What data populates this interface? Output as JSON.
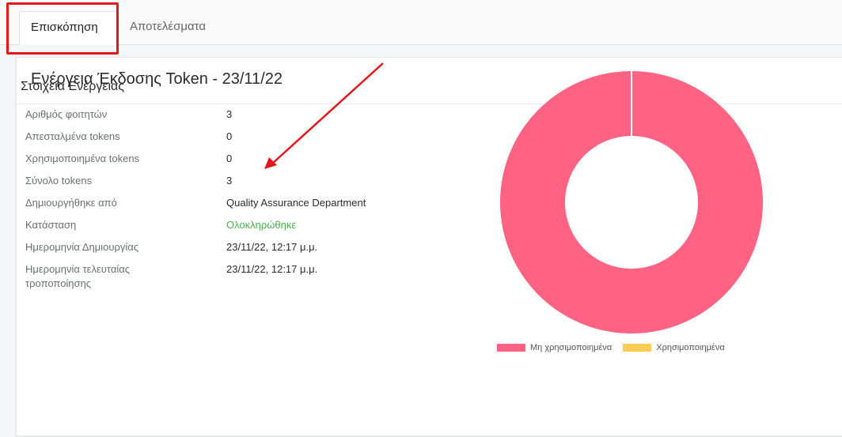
{
  "tabs": [
    {
      "label": "Επισκόπηση",
      "active": true
    },
    {
      "label": "Αποτελέσματα",
      "active": false
    }
  ],
  "card": {
    "title": "Ενέργεια Έκδοσης Token - 23/11/22"
  },
  "details": {
    "title": "Στοιχεία Ενέργειας",
    "rows": [
      {
        "label": "Αριθμός φοιτητών",
        "value": "3"
      },
      {
        "label": "Απεσταλμένα tokens",
        "value": "0"
      },
      {
        "label": "Χρησιμοποιημένα tokens",
        "value": "0"
      },
      {
        "label": "Σύνολο tokens",
        "value": "3"
      },
      {
        "label": "Δημιουργήθηκε από",
        "value": "Quality Assurance Department"
      },
      {
        "label": "Κατάσταση",
        "value": "Ολοκληρώθηκε"
      },
      {
        "label": "Ημερομηνία Δημιουργίας",
        "value": "23/11/22, 12:17 μ.μ."
      },
      {
        "label": "Ημερομηνία τελευταίας τροποποίησης",
        "value": "23/11/22, 12:17 μ.μ."
      }
    ]
  },
  "colors": {
    "unused": "#ff6384",
    "used": "#ffcd56",
    "status": "#4caf50",
    "annotation": "#e3161c"
  },
  "chart_data": {
    "type": "pie",
    "donut": true,
    "categories": [
      "Μη χρησιμοποιημένα",
      "Χρησιμοποιημένα"
    ],
    "values": [
      3,
      0
    ],
    "legend": "bottom"
  }
}
